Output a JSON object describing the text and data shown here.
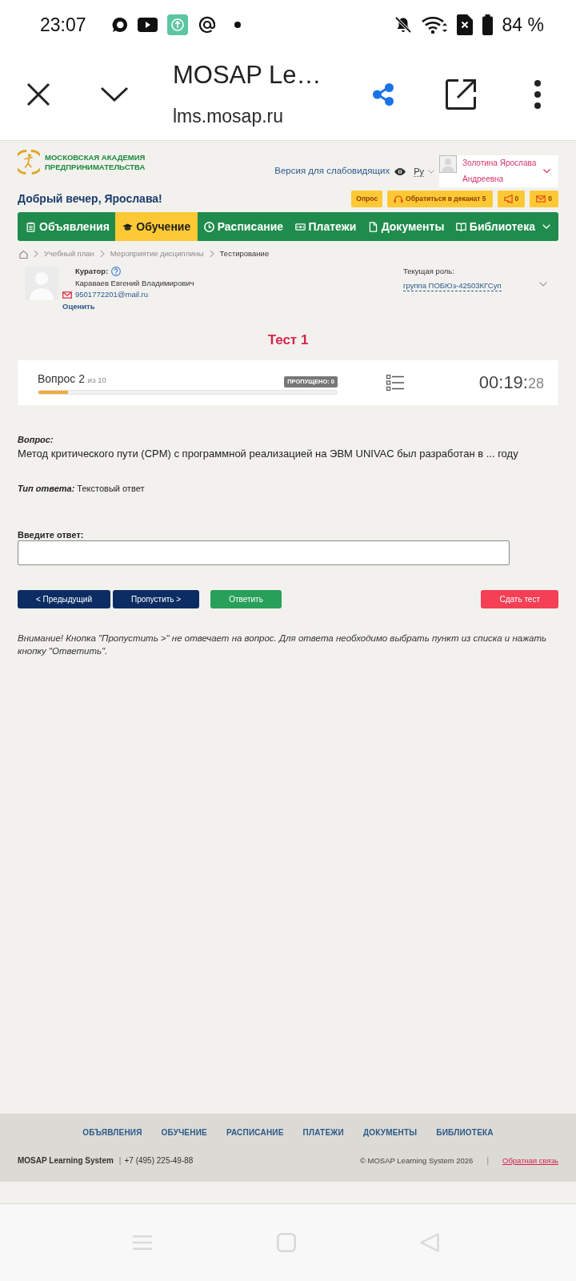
{
  "status_bar": {
    "time": "23:07",
    "battery": "84 %"
  },
  "browser": {
    "title": "MOSAP Le…",
    "url": "lms.mosap.ru"
  },
  "header": {
    "logo_lines": [
      "МОСКОВСКАЯ АКАДЕМИЯ",
      "ПРЕДПРИНИМАТЕЛЬСТВА"
    ],
    "accessibility_link": "Версия для слабовидящих",
    "language": "Ру",
    "user_name": "Золотина Ярослава Андреевна",
    "greeting": "Добрый вечер, Ярослава!",
    "action_buttons": [
      {
        "kind": "text",
        "label": "Опрос"
      },
      {
        "kind": "headset",
        "label": "Обратиться в деканат 5"
      },
      {
        "kind": "megaphone",
        "label": "0"
      },
      {
        "kind": "mail",
        "label": "0"
      }
    ]
  },
  "nav": [
    {
      "kind": "clipboard",
      "label": "Объявления",
      "selected": false,
      "dropdown": false
    },
    {
      "kind": "cap",
      "label": "Обучение",
      "selected": true,
      "dropdown": false
    },
    {
      "kind": "clock",
      "label": "Расписание",
      "selected": false,
      "dropdown": false
    },
    {
      "kind": "money",
      "label": "Платежи",
      "selected": false,
      "dropdown": false
    },
    {
      "kind": "document",
      "label": "Документы",
      "selected": false,
      "dropdown": false
    },
    {
      "kind": "book",
      "label": "Библиотека",
      "selected": false,
      "dropdown": true
    }
  ],
  "breadcrumb": [
    "Учебный план",
    "Мероприятие дисциплины",
    "Тестирование"
  ],
  "curator": {
    "label": "Куратор:",
    "name": "Караваев Евгений Владимирович",
    "email": "9501772201@mail.ru",
    "rate_link": "Оценить"
  },
  "role": {
    "label": "Текущая роль:",
    "value": "группа ПОБЮз-42503КГСуп"
  },
  "test": {
    "title": "Тест 1",
    "question": "Вопрос 2",
    "question_total": "из 10",
    "skipped": "ПРОПУЩЕНО: 0",
    "progress": {
      "level": 0.1
    },
    "timer": "00:19:",
    "timer_seconds": "28"
  },
  "question": {
    "label": "Вопрос:",
    "text": "Метод критического пути (CPM) с программной реализацией на ЭВМ UNIVAC был разработан в ... году",
    "answer_type_label": "Тип ответа:",
    "answer_type": "Текстовый ответ"
  },
  "answer": {
    "label": "Введите ответ:"
  },
  "buttons": [
    {
      "kind": "back",
      "label": "< Предыдущий"
    },
    {
      "kind": "skip",
      "label": "Пропустить >"
    },
    {
      "kind": "answer",
      "label": "Ответить"
    },
    {
      "kind": "finish",
      "label": "Сдать тест"
    }
  ],
  "note": "Внимание! Кнопка \"Пропустить >\" не отвечает на вопрос. Для ответа необходимо выбрать пункт из списка и нажать кнопку \"Ответить\".",
  "footer": {
    "links": [
      "ОБЪЯВЛЕНИЯ",
      "ОБУЧЕНИЕ",
      "РАСПИСАНИЕ",
      "ПЛАТЕЖИ",
      "ДОКУМЕНТЫ",
      "БИБЛИОТЕКА"
    ],
    "brand": "MOSAP Learning System",
    "phone_separator": "|",
    "phone": "+7 (495) 225-49-88",
    "copyright": "© MOSAP Learning System 2026",
    "separator": "|",
    "feedback": "Обратная связь"
  }
}
